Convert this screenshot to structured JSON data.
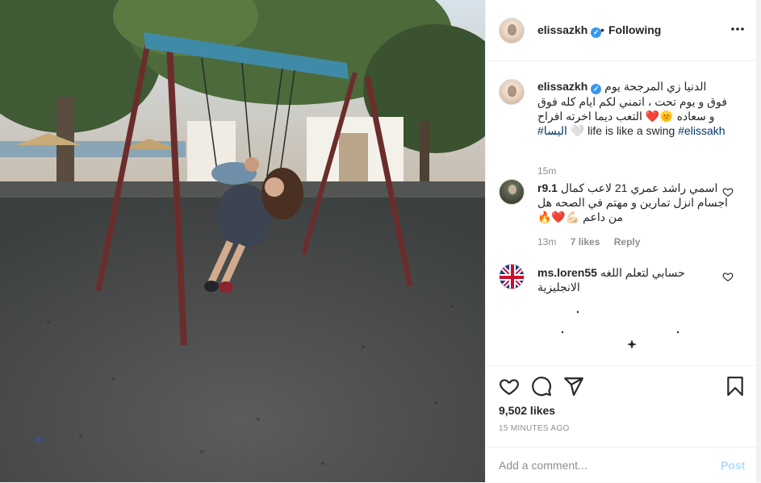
{
  "post": {
    "header": {
      "username": "elissazkh",
      "verified_mark": "✓",
      "separator": "•",
      "follow_status": "Following"
    },
    "caption": {
      "username": "elissazkh",
      "text": "الدنيا زي المرجحة يوم فوق و يوم تحت ، اتمني لكم ايام كله فوق و سعاده 🌞❤️ التعب ديما اخرته افراح",
      "hashtag_arabic": "#اليسا",
      "heart": "🤍",
      "english_text": "life is like a swing",
      "hashtag": "#elissakh",
      "time": "15m"
    },
    "comments": [
      {
        "username": "r9.1",
        "text": "اسمي راشد عمري 21 لاعب كمال اجسام انزل تمارين و مهتم في الصحه هل من داعم 💪🏻❤️🔥",
        "time": "13m",
        "likes": "7 likes",
        "reply": "Reply"
      },
      {
        "username": "ms.loren55",
        "text": "حسابي لتعلم اللغه الانجليزية"
      }
    ],
    "likes": "9,502 likes",
    "timestamp": "15 MINUTES AGO",
    "add_comment": {
      "placeholder": "Add a comment...",
      "post_label": "Post"
    },
    "icons": {
      "more": "more-horizontal-icon",
      "like": "heart-icon",
      "comment": "comment-bubble-icon",
      "share": "paper-plane-icon",
      "save": "bookmark-icon"
    },
    "colors": {
      "verified": "#3897f0",
      "hashtag": "#00376b",
      "post_button": "#b3dbff",
      "muted": "#8e8e8e"
    }
  }
}
